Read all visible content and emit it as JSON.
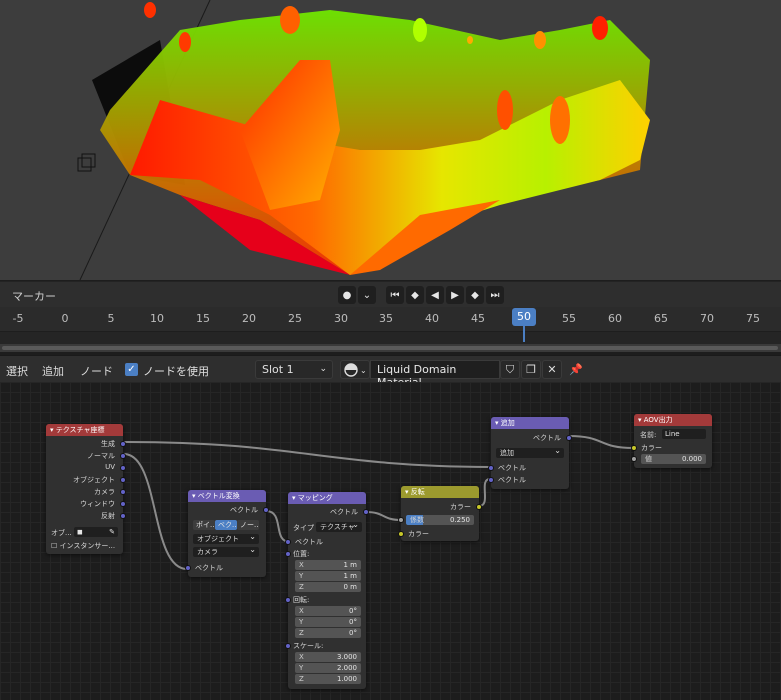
{
  "timeline": {
    "marker_menu": "マーカー",
    "frames": [
      "-5",
      "0",
      "5",
      "10",
      "15",
      "20",
      "25",
      "30",
      "35",
      "40",
      "45",
      "50",
      "55",
      "60",
      "65",
      "70",
      "75"
    ],
    "current_frame": "50"
  },
  "node_header": {
    "menu_select": "選択",
    "menu_add": "追加",
    "menu_node": "ノード",
    "use_nodes_label": "ノードを使用",
    "slot": "Slot 1",
    "material_name": "Liquid Domain Material"
  },
  "nodes": {
    "texcoord": {
      "title": "テクスチャ座標",
      "outputs": [
        "生成",
        "ノーマル",
        "UV",
        "オブジェクト",
        "カメラ",
        "ウィンドウ",
        "反射"
      ],
      "object_label": "オブ...",
      "from_instancer": "インスタンサー..."
    },
    "vecxform": {
      "title": "ベクトル変換",
      "output": "ベクトル",
      "tabs": [
        "ポイ...",
        "ベク...",
        "ノー..."
      ],
      "convert_from": "オブジェクト",
      "convert_to": "カメラ",
      "input": "ベクトル"
    },
    "mapping": {
      "title": "マッピング",
      "output": "ベクトル",
      "type_label": "タイプ",
      "type_value": "テクスチャ",
      "vector_in": "ベクトル",
      "location_label": "位置:",
      "location": [
        {
          "axis": "X",
          "value": "1 m"
        },
        {
          "axis": "Y",
          "value": "1 m"
        },
        {
          "axis": "Z",
          "value": "0 m"
        }
      ],
      "rotation_label": "回転:",
      "rotation": [
        {
          "axis": "X",
          "value": "0°"
        },
        {
          "axis": "Y",
          "value": "0°"
        },
        {
          "axis": "Z",
          "value": "0°"
        }
      ],
      "scale_label": "スケール:",
      "scale": [
        {
          "axis": "X",
          "value": "3.000"
        },
        {
          "axis": "Y",
          "value": "2.000"
        },
        {
          "axis": "Z",
          "value": "1.000"
        }
      ]
    },
    "invert": {
      "title": "反転",
      "output": "カラー",
      "fac_label": "係数",
      "fac_value": "0.250",
      "color_in": "カラー"
    },
    "add": {
      "title": "追加",
      "output": "ベクトル",
      "operation": "追加",
      "input1": "ベクトル",
      "input2": "ベクトル"
    },
    "aov": {
      "title": "AOV出力",
      "name_label": "名前:",
      "name_value": "Line",
      "color_in": "カラー",
      "value_label": "値",
      "value_value": "0.000"
    }
  },
  "colors": {
    "accent": "#4b7fc4",
    "input_node": "#a33a3a",
    "vector_node": "#6a5cb3",
    "color_node": "#9c9a2e",
    "output_node": "#a33a3a"
  }
}
